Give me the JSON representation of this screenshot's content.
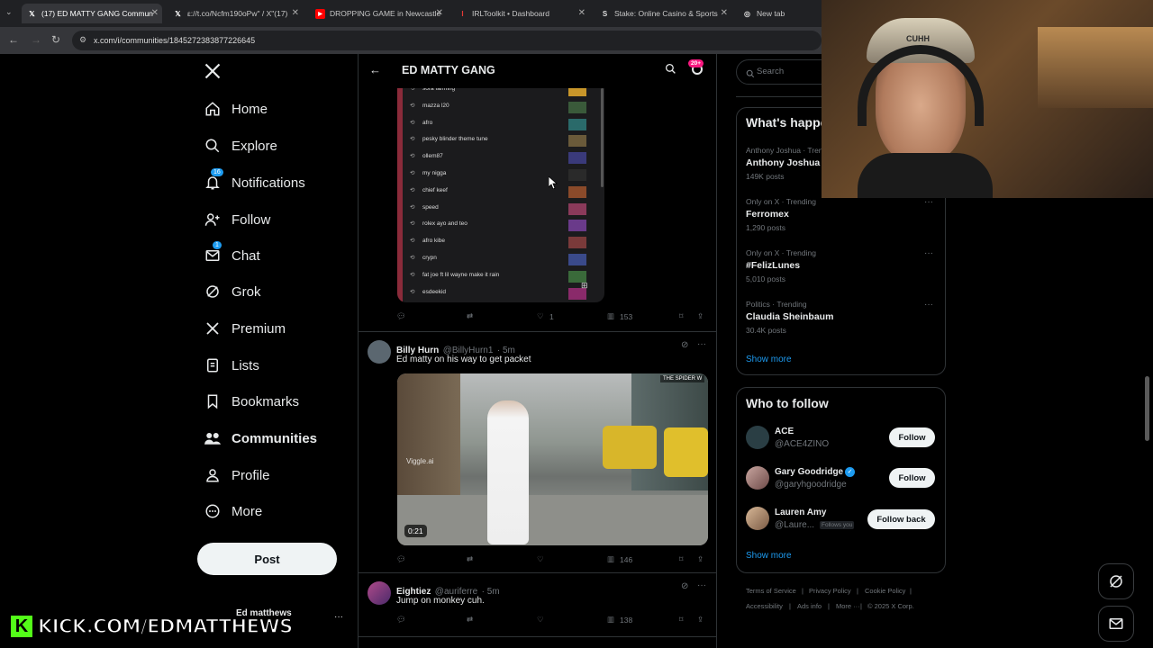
{
  "browser": {
    "tabs": [
      {
        "title": "(17) ED MATTY GANG Commun",
        "favicon": "X"
      },
      {
        "title": "ε://t.co/Ncfm190oPw\" / X\"(17)",
        "favicon": "X"
      },
      {
        "title": "DROPPING GAME in Newcastle",
        "favicon": "▶"
      },
      {
        "title": "IRLToolkit • Dashboard",
        "favicon": "I"
      },
      {
        "title": "Stake: Online Casino & Sports",
        "favicon": "S"
      },
      {
        "title": "New tab",
        "favicon": "◎"
      }
    ],
    "url": "x.com/i/communities/1845272383877226645"
  },
  "sidebar": {
    "items": [
      {
        "label": "Home",
        "icon": "home-icon"
      },
      {
        "label": "Explore",
        "icon": "search-icon"
      },
      {
        "label": "Notifications",
        "icon": "bell-icon",
        "badge": "16"
      },
      {
        "label": "Follow",
        "icon": "person-add-icon"
      },
      {
        "label": "Chat",
        "icon": "mail-icon",
        "badge": "1"
      },
      {
        "label": "Grok",
        "icon": "grok-icon"
      },
      {
        "label": "Premium",
        "icon": "x-logo-icon"
      },
      {
        "label": "Lists",
        "icon": "list-icon"
      },
      {
        "label": "Bookmarks",
        "icon": "bookmark-icon"
      },
      {
        "label": "Communities",
        "icon": "communities-icon"
      },
      {
        "label": "Profile",
        "icon": "person-icon"
      },
      {
        "label": "More",
        "icon": "more-circle-icon"
      }
    ],
    "post_label": "Post",
    "account_name": "Ed matthews",
    "account_more": "···"
  },
  "header": {
    "title": "ED MATTY GANG",
    "badge": "20+"
  },
  "playlist": {
    "items": [
      "sora farming",
      "mazza l20",
      "afro",
      "pesky blinder theme tune",
      "ollem87",
      "my nigga",
      "chief keef",
      "speed",
      "rolex ayo and teo",
      "afro kibe",
      "crypn",
      "fat joe ft lil wayne make it rain",
      "esdeekid"
    ]
  },
  "posts": [
    {
      "likes": "1",
      "views": "153"
    },
    {
      "name": "Billy Hurn",
      "handle": "@BillyHurn1",
      "time": "· 5m",
      "text": "Ed matty on his way to get packet",
      "video_duration": "0:21",
      "video_watermark": "THE SPIDER W",
      "video_logo": "Viggle.ai",
      "views": "146"
    },
    {
      "name": "Eightiez",
      "handle": "@auriferre",
      "time": "· 5m",
      "text": "Jump on monkey cuh.",
      "views": "138"
    }
  ],
  "right": {
    "search_placeholder": "Search",
    "trends_title": "What's happening",
    "trends": [
      {
        "meta": "Anthony Joshua · Trending",
        "title": "Anthony Joshua",
        "posts": "149K posts"
      },
      {
        "meta": "Only on X · Trending",
        "title": "Ferromex",
        "posts": "1,290 posts"
      },
      {
        "meta": "Only on X · Trending",
        "title": "#FelizLunes",
        "posts": "5,010 posts"
      },
      {
        "meta": "Politics · Trending",
        "title": "Claudia Sheinbaum",
        "posts": "30.4K posts"
      }
    ],
    "show_more": "Show more",
    "wtf_title": "Who to follow",
    "who_to_follow": [
      {
        "name": "ACE",
        "handle": "@ACE4ZINO",
        "button": "Follow"
      },
      {
        "name": "Gary Goodridge",
        "handle": "@garyhgoodridge",
        "button": "Follow",
        "verified": true
      },
      {
        "name": "Lauren Amy",
        "handle": "@Laure...",
        "button": "Follow back",
        "follows_you": "Follows you"
      }
    ],
    "wtf_show_more": "Show more",
    "footer": [
      "Terms of Service",
      "Privacy Policy",
      "Cookie Policy",
      "Accessibility",
      "Ads info",
      "More ···",
      "© 2025 X Corp."
    ]
  },
  "overlay": {
    "kick_text": "KICK.COM/EDMATTHEWS",
    "cap_text": "CUHH"
  },
  "colors": {
    "accent": "#1d9bf0",
    "kick_green": "#53fc18"
  }
}
